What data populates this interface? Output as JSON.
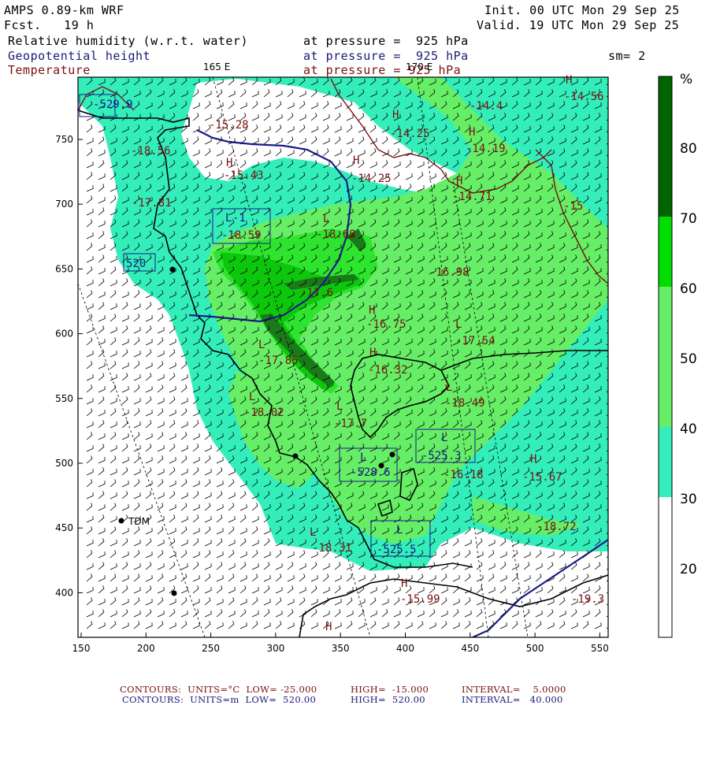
{
  "header": {
    "model": "AMPS 0.89-km WRF",
    "forecast": "Fcst.   19 h",
    "init": "Init. 00 UTC Mon 29 Sep 25",
    "valid": "Valid. 19 UTC Mon 29 Sep 25",
    "field1": "Relative humidity (w.r.t. water)",
    "field2": "Geopotential height",
    "field3": "Temperature",
    "pressure1": "at pressure =  925 hPa",
    "pressure2": "at pressure =  925 hPa",
    "pressure3": "at pressure = 925 hPa",
    "smoothing": "sm= 2",
    "lon_label_1": "165 E",
    "lon_label_2": "170 E"
  },
  "axes": {
    "x_ticks": [
      "150",
      "200",
      "250",
      "300",
      "350",
      "400",
      "450",
      "500",
      "550"
    ],
    "y_ticks": [
      "750",
      "700",
      "650",
      "600",
      "550",
      "500",
      "450",
      "400"
    ]
  },
  "colorbar": {
    "unit": "%",
    "ticks": [
      "80",
      "70",
      "60",
      "50",
      "40",
      "30",
      "20"
    ],
    "colors": [
      "#006400",
      "#00dd00",
      "#66ee66",
      "#33eebb",
      "#ffffff"
    ]
  },
  "stations": {
    "tdm": "TDM"
  },
  "map_labels": {
    "height_boxes": [
      "L",
      "-1",
      "520",
      "L",
      "-528.6",
      "L",
      "-525.3",
      "L",
      "-525.5",
      "L",
      "-529.9"
    ],
    "temps": [
      "-14.4",
      "-14.56",
      "-15.28",
      "-18.56",
      "-15.43",
      "-14.25",
      "-14.25",
      "-14.19",
      "-14.71",
      "-15",
      "-17.81",
      "-18.59",
      "-18.68",
      "-16.98",
      "-17.6",
      "-16.75",
      "-17.54",
      "-17.85",
      "-16.32",
      "-18.02",
      "-18.49",
      "-17.7",
      "-16.18",
      "-15.67",
      "-18.72",
      "-18.31",
      "-15.99",
      "-19.3"
    ],
    "highs_lows": [
      "H",
      "L"
    ]
  },
  "footer": {
    "line1_a": "CONTOURS:  UNITS=°C  LOW= -25.000",
    "line1_b": "HIGH=  -15.000",
    "line1_c": "INTERVAL=    5.0000",
    "line2_a": "CONTOURS:  UNITS=m  LOW=  520.00",
    "line2_b": "HIGH=  520.00",
    "line2_c": "INTERVAL=   40.000"
  }
}
